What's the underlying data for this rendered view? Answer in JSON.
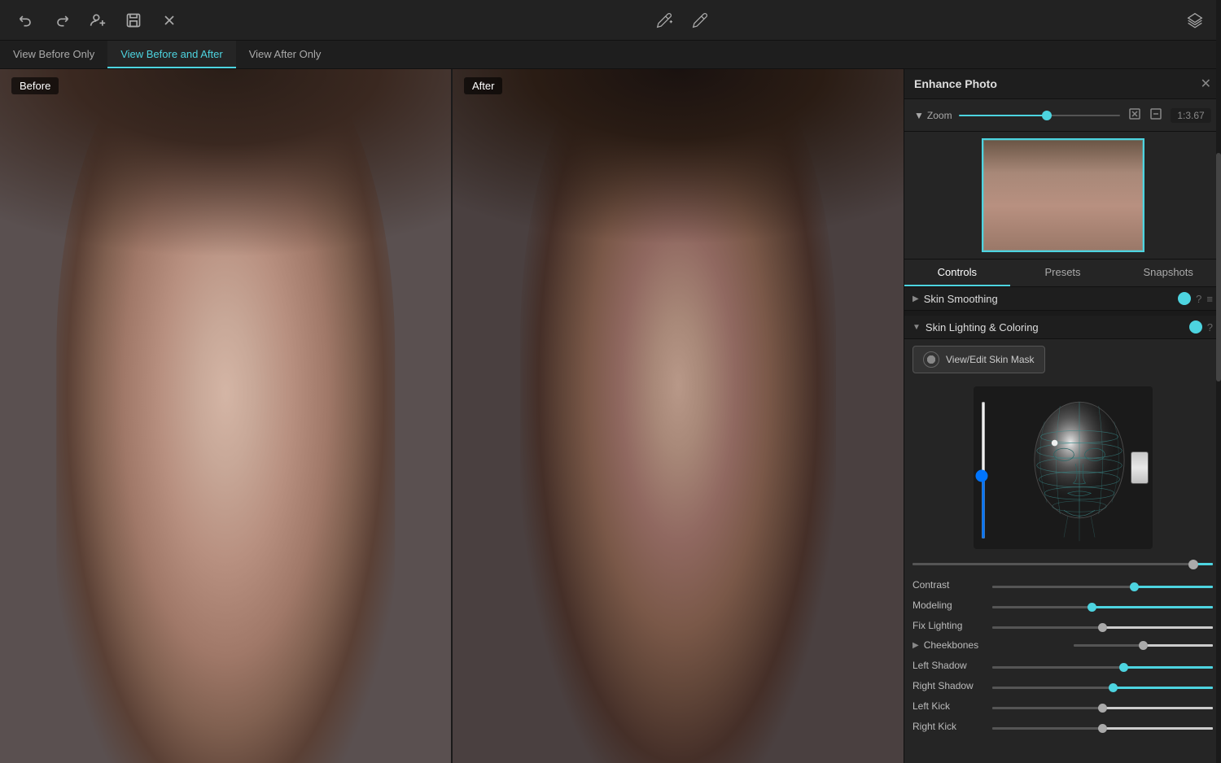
{
  "app": {
    "title": "Enhance Photo"
  },
  "toolbar": {
    "undo_label": "Undo",
    "redo_label": "Redo",
    "add_person_label": "Add Person",
    "save_label": "Save",
    "close_label": "Close",
    "pen_add_label": "Add Pen",
    "pen_remove_label": "Remove Pen",
    "layers_label": "Layers"
  },
  "view_tabs": {
    "before_only": "View Before Only",
    "before_and_after": "View Before and After",
    "after_only": "View After Only",
    "active": "before_and_after"
  },
  "panels": {
    "before_label": "Before",
    "after_label": "After"
  },
  "right_panel": {
    "title": "Enhance Photo",
    "zoom": {
      "label": "Zoom",
      "value": "1:3.67"
    },
    "tabs": [
      {
        "id": "controls",
        "label": "Controls"
      },
      {
        "id": "presets",
        "label": "Presets"
      },
      {
        "id": "snapshots",
        "label": "Snapshots"
      }
    ],
    "active_tab": "controls",
    "sections": {
      "skin_smoothing": {
        "title": "Skin Smoothing",
        "collapsed": true
      },
      "skin_lighting": {
        "title": "Skin Lighting & Coloring",
        "power_on": true,
        "view_edit_skin_mask": "View/Edit Skin Mask",
        "controls": [
          {
            "id": "contrast",
            "label": "Contrast",
            "value": 65,
            "has_teal": true
          },
          {
            "id": "modeling",
            "label": "Modeling",
            "value": 45,
            "has_teal": true
          },
          {
            "id": "fix_lighting",
            "label": "Fix Lighting",
            "value": 50,
            "has_teal": false
          }
        ]
      },
      "cheekbones": {
        "title": "Cheekbones",
        "controls": [
          {
            "id": "left_shadow",
            "label": "Left Shadow",
            "value": 60,
            "has_teal": true
          },
          {
            "id": "right_shadow",
            "label": "Right Shadow",
            "value": 55,
            "has_teal": true
          },
          {
            "id": "left_kick",
            "label": "Left Kick",
            "value": 50,
            "has_teal": false
          },
          {
            "id": "right_kick",
            "label": "Right Kick",
            "value": 50,
            "has_teal": false
          }
        ]
      }
    }
  }
}
